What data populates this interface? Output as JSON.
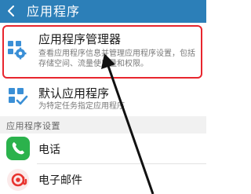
{
  "header": {
    "title": "应用程序",
    "back_icon": "back-arrow-icon"
  },
  "items": [
    {
      "title": "应用程序管理器",
      "description": "查看应用程序信息并管理应用程序设置，包括存储空间、流量使用量和权限。",
      "icon": "app-manager-icon",
      "highlighted": true
    },
    {
      "title": "默认应用程序",
      "description": "为特定任务指定应用程序",
      "icon": "default-apps-icon"
    }
  ],
  "section": {
    "header": "应用程序设置"
  },
  "apps": [
    {
      "title": "电话",
      "icon": "phone-icon"
    },
    {
      "title": "电子邮件",
      "icon": "email-icon"
    }
  ],
  "colors": {
    "titlebar": "#2c7fb8",
    "highlight_border": "#e8262e",
    "icon_blue": "#3a8fd6",
    "phone_green": "#2bb24c",
    "email_red": "#e8342f"
  }
}
